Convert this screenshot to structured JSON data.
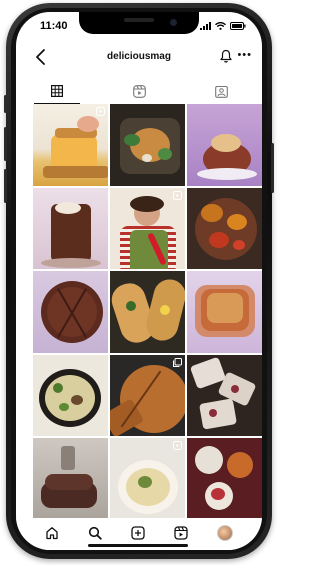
{
  "status": {
    "time": "11:40"
  },
  "header": {
    "username": "deliciousmag"
  },
  "tabs": [
    {
      "name": "posts",
      "icon": "grid-icon",
      "active": true
    },
    {
      "name": "reels",
      "icon": "reels-icon",
      "active": false
    },
    {
      "name": "tagged",
      "icon": "tagged-icon",
      "active": false
    }
  ],
  "grid": [
    {
      "subject": "grilled cheese sandwich",
      "badge": "reel-icon"
    },
    {
      "subject": "roast chicken tray",
      "badge": "none"
    },
    {
      "subject": "bundt cake",
      "badge": "none"
    },
    {
      "subject": "chocolate cake stack",
      "badge": "none"
    },
    {
      "subject": "chef in green apron",
      "badge": "reel-icon"
    },
    {
      "subject": "chicken traybake",
      "badge": "none"
    },
    {
      "subject": "chocolate tart",
      "badge": "none"
    },
    {
      "subject": "stuffed flatbreads",
      "badge": "none"
    },
    {
      "subject": "crumble dish",
      "badge": "none"
    },
    {
      "subject": "pasta skillet",
      "badge": "none"
    },
    {
      "subject": "chocolate tart slices",
      "badge": "carousel-icon"
    },
    {
      "subject": "tart slices",
      "badge": "none"
    },
    {
      "subject": "pancake stack",
      "badge": "none"
    },
    {
      "subject": "pasta bowls",
      "badge": "reel-icon"
    },
    {
      "subject": "desserts in pots",
      "badge": "none"
    }
  ],
  "nav": [
    "home-icon",
    "search-icon",
    "add-post-icon",
    "reels-nav-icon",
    "profile-avatar"
  ],
  "colors": {
    "accent": "#111111",
    "background": "#ffffff"
  }
}
